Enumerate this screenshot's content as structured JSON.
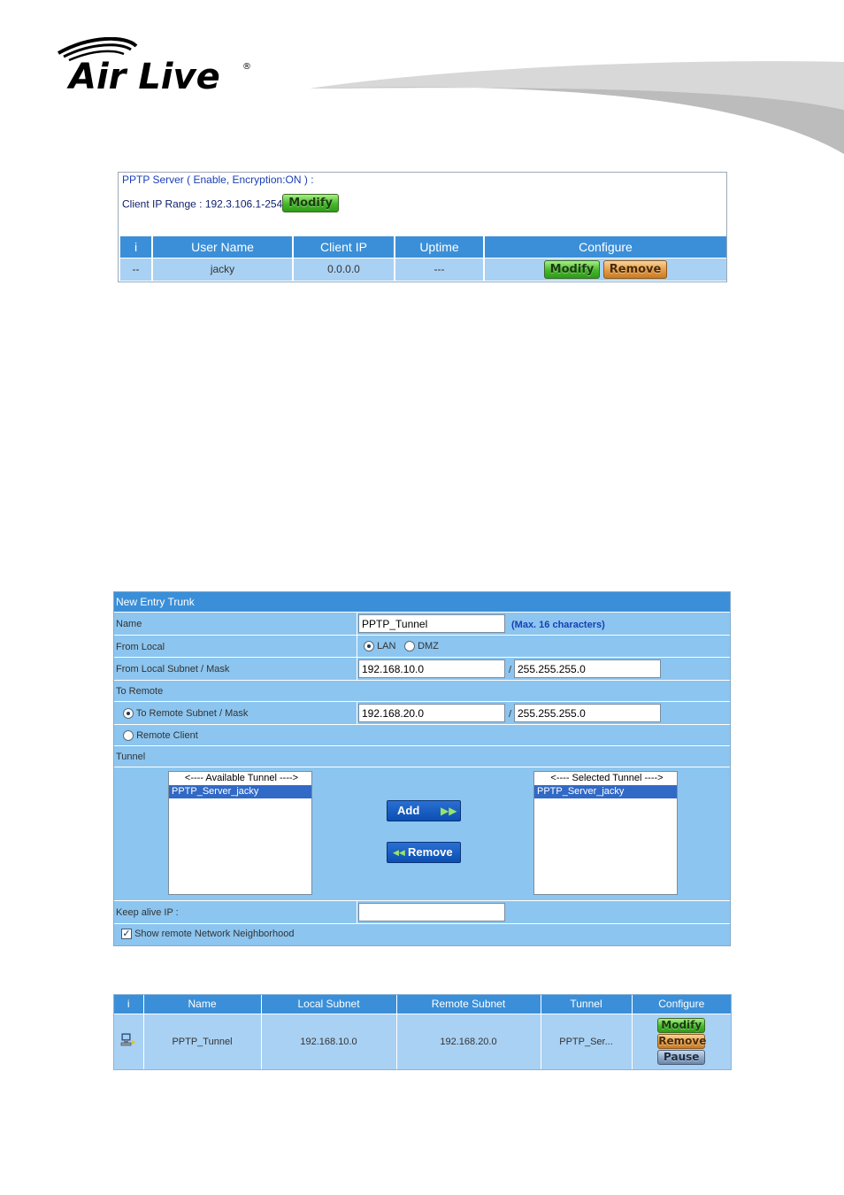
{
  "brand": {
    "logo_text": "Air Live"
  },
  "pptp_server": {
    "status_prefix": "PPTP Server ( ",
    "status_value": "Enable, Encryption:ON",
    "status_suffix": " ) :",
    "client_ip_range_label": "Client IP Range : 192.3.106.1-254",
    "modify_label": "Modify",
    "table": {
      "headers": [
        "i",
        "User Name",
        "Client IP",
        "Uptime",
        "Configure"
      ],
      "rows": [
        {
          "i": "--",
          "user_name": "jacky",
          "client_ip": "0.0.0.0",
          "uptime": "---",
          "modify": "Modify",
          "remove": "Remove"
        }
      ]
    }
  },
  "new_entry": {
    "title": "New Entry Trunk",
    "name_label": "Name",
    "name_value": "PPTP_Tunnel",
    "name_hint": "(Max. 16 characters)",
    "from_local_label": "From Local",
    "lan_label": "LAN",
    "dmz_label": "DMZ",
    "from_local_subnet_label": "From Local Subnet / Mask",
    "local_subnet_value": "192.168.10.0",
    "local_mask_value": "255.255.255.0",
    "slash": "/",
    "to_remote_label": "To Remote",
    "to_remote_subnet_label": "To Remote Subnet / Mask",
    "remote_subnet_value": "192.168.20.0",
    "remote_mask_value": "255.255.255.0",
    "remote_client_label": "Remote Client",
    "tunnel_label": "Tunnel",
    "available_title": "<---- Available Tunnel ---->",
    "available_items": [
      "PPTP_Server_jacky"
    ],
    "selected_title": "<---- Selected Tunnel ---->",
    "selected_items": [
      "PPTP_Server_jacky"
    ],
    "add_label": "Add",
    "remove_label": "Remove",
    "keep_alive_label": "Keep alive IP :",
    "keep_alive_value": "",
    "show_neighborhood_label": "Show remote Network Neighborhood",
    "show_neighborhood_checked": true
  },
  "trunk_list": {
    "headers": [
      "i",
      "Name",
      "Local Subnet",
      "Remote Subnet",
      "Tunnel",
      "Configure"
    ],
    "rows": [
      {
        "name": "PPTP_Tunnel",
        "local_subnet": "192.168.10.0",
        "remote_subnet": "192.168.20.0",
        "tunnel": "PPTP_Ser...",
        "modify": "Modify",
        "remove": "Remove",
        "pause": "Pause"
      }
    ]
  }
}
